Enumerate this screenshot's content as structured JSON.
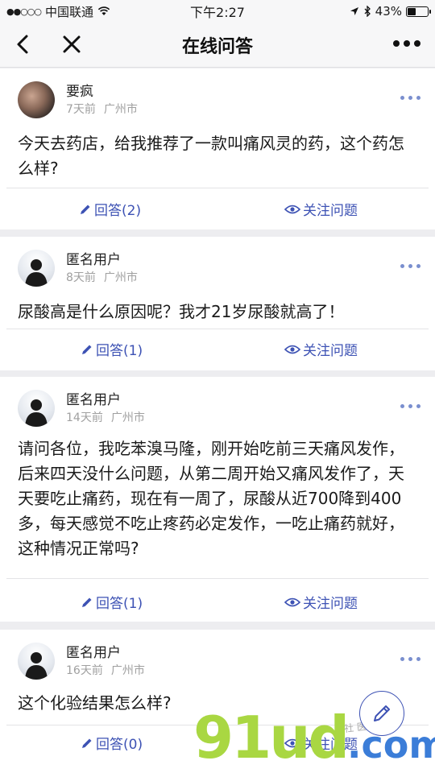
{
  "status_bar": {
    "signal_dots": "●●○○○",
    "carrier": "中国联通",
    "time": "下午2:27",
    "battery_percent": "43%",
    "battery_level": 0.43
  },
  "nav": {
    "title": "在线问答"
  },
  "questions": [
    {
      "user": "要疯",
      "time": "7天前",
      "city": "广州市",
      "text": "今天去药店，给我推荐了一款叫痛风灵的药，这个药怎么样?",
      "answer_label": "回答(2)",
      "follow_label": "关注问题"
    },
    {
      "user": "匿名用户",
      "time": "8天前",
      "city": "广州市",
      "text": "尿酸高是什么原因呢？我才21岁尿酸就高了！",
      "answer_label": "回答(1)",
      "follow_label": "关注问题"
    },
    {
      "user": "匿名用户",
      "time": "14天前",
      "city": "广州市",
      "text": "请问各位，我吃苯溴马隆，刚开始吃前三天痛风发作，后来四天没什么问题，从第二周开始又痛风发作了，天天要吃止痛药，现在有一周了，尿酸从近700降到400多，每天感觉不吃止疼药必定发作，一吃止痛药就好，这种情况正常吗?",
      "answer_label": "回答(1)",
      "follow_label": "关注问题"
    },
    {
      "user": "匿名用户",
      "time": "16天前",
      "city": "广州市",
      "text": "这个化验结果怎么样?",
      "answer_label": "回答(0)",
      "follow_label": "关注问题"
    }
  ],
  "watermark": {
    "logo_main": "91ud",
    "logo_suffix": ".com",
    "side_text": "社 医 商 店"
  },
  "colors": {
    "accent": "#3d52b4",
    "watermark_green": "#a9d742",
    "watermark_blue": "#3b7dd8"
  }
}
